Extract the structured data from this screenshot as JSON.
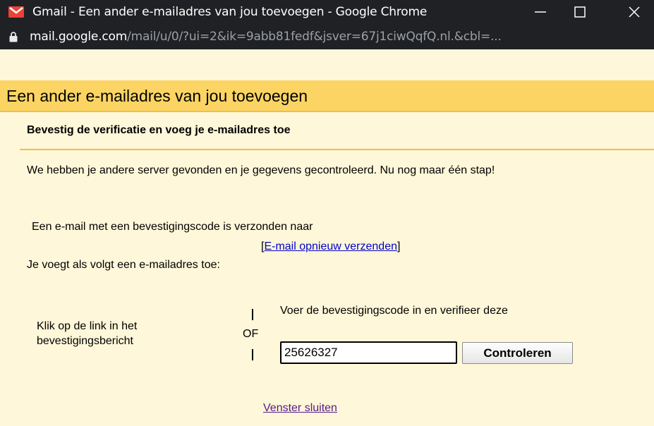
{
  "window": {
    "title": "Gmail - Een ander e-mailadres van jou toevoegen - Google Chrome",
    "url_host": "mail.google.com",
    "url_path": "/mail/u/0/?ui=2&ik=9abb81fedf&jsver=67j1ciwQqfQ.nl.&cbl=..."
  },
  "dialog": {
    "title": "Een ander e-mailadres van jou toevoegen",
    "step_title": "Bevestig de verificatie en voeg je e-mailadres toe",
    "intro": "We hebben je andere server gevonden en je gegevens gecontroleerd. Nu nog maar één stap!",
    "sent_text": "Een e-mail met een bevestigingscode is verzonden naar",
    "resend_open": "[",
    "resend_link": "E-mail opnieuw verzenden",
    "resend_close": "]",
    "adding_text": "Je voegt als volgt een e-mailadres toe:",
    "click_link_text": "Klik op de link in het bevestigingsbericht",
    "or_label": "OF",
    "enter_code_text": "Voer de bevestigingscode in en verifieer deze",
    "code_value": "25626327",
    "check_button": "Controleren",
    "close_link": "Venster sluiten"
  },
  "colors": {
    "titlebar": "#202124",
    "header": "#fbd463",
    "body": "#fff7d9",
    "link": "#0000cc",
    "visited_link": "#551a8b",
    "gmail_red": "#ea4335"
  }
}
